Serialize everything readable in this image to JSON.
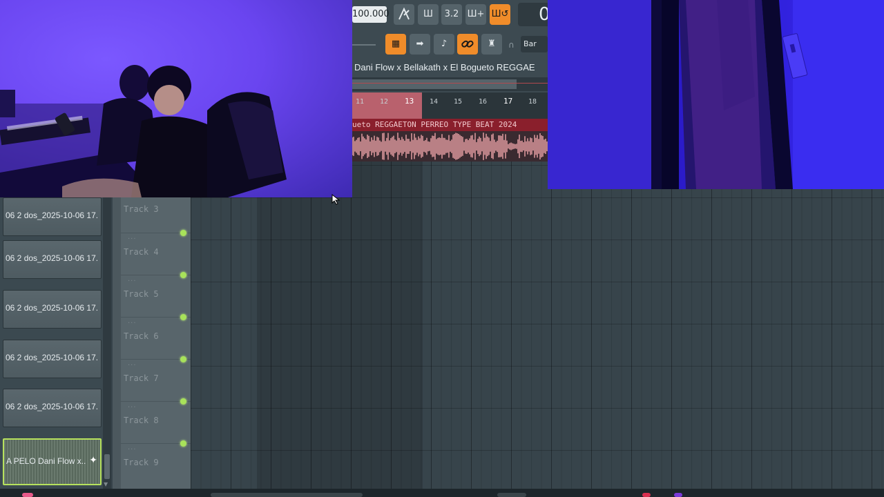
{
  "toolbar": {
    "tempo": "100.000",
    "buttons": [
      {
        "name": "metronome-icon",
        "glyph": "⍲",
        "on": false
      },
      {
        "name": "wait-for-input-icon",
        "glyph": "Ш",
        "on": false
      },
      {
        "name": "countdown-icon",
        "glyph": "3.2",
        "on": false
      },
      {
        "name": "step-edit-icon",
        "glyph": "Ш+",
        "on": false
      },
      {
        "name": "loop-record-icon",
        "glyph": "Ш↺",
        "on": true
      }
    ],
    "time_display": "0",
    "tools": [
      {
        "name": "playlist-icon",
        "glyph": "▦",
        "on": true
      },
      {
        "name": "arrow-icon",
        "glyph": "➡",
        "on": false
      },
      {
        "name": "brush-icon",
        "glyph": "♪",
        "on": false
      },
      {
        "name": "link-icon",
        "glyph": "🔗",
        "on": true
      },
      {
        "name": "stamp-icon",
        "glyph": "♜",
        "on": false
      }
    ],
    "snap": "Bar"
  },
  "playlist": {
    "title": "Dani Flow x Bellakath x El Bogueto  REGGAE",
    "ruler_bars": [
      "11",
      "12",
      "13",
      "14",
      "15",
      "16",
      "17",
      "18"
    ],
    "current_bar": "13",
    "audio_clip_label": "ueto  REGGAETON PERREO TYPE BEAT 2024"
  },
  "clips": [
    {
      "label": "06 2 dos_2025-10-06 17..",
      "active": false
    },
    {
      "label": "06 2 dos_2025-10-06 17..",
      "active": false
    },
    {
      "label": "06 2 dos_2025-10-06 17..",
      "active": false
    },
    {
      "label": "06 2 dos_2025-10-06 17..",
      "active": false
    },
    {
      "label": "06 2 dos_2025-10-06 17..",
      "active": false
    },
    {
      "label": "A PELO  Dani Flow x..",
      "active": true
    }
  ],
  "tracks": [
    "Track 3",
    "Track 4",
    "Track 5",
    "Track 6",
    "Track 7",
    "Track 8",
    "Track 9"
  ],
  "colors": {
    "accent_orange": "#f08c2a",
    "loop_pink": "#b9616d",
    "clip_red": "#8a1f2c",
    "led_green": "#a8e25a",
    "webcam_purple": "#6a45f0"
  }
}
